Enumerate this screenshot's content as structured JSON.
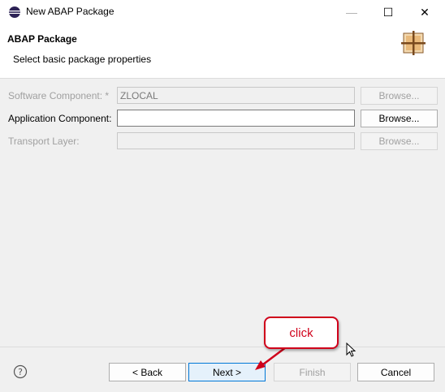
{
  "window": {
    "title": "New ABAP Package",
    "minimize": "—",
    "maximize": "☐",
    "close": "✕"
  },
  "header": {
    "title": "ABAP Package",
    "subtitle": "Select basic package properties"
  },
  "form": {
    "software_component": {
      "label": "Software Component: *",
      "value": "ZLOCAL",
      "browse": "Browse..."
    },
    "application_component": {
      "label": "Application Component:",
      "value": "",
      "browse": "Browse..."
    },
    "transport_layer": {
      "label": "Transport Layer:",
      "value": "",
      "browse": "Browse..."
    }
  },
  "footer": {
    "back": "< Back",
    "next": "Next >",
    "finish": "Finish",
    "cancel": "Cancel"
  },
  "annotation": {
    "callout_text": "click",
    "color": "#d0021b"
  }
}
